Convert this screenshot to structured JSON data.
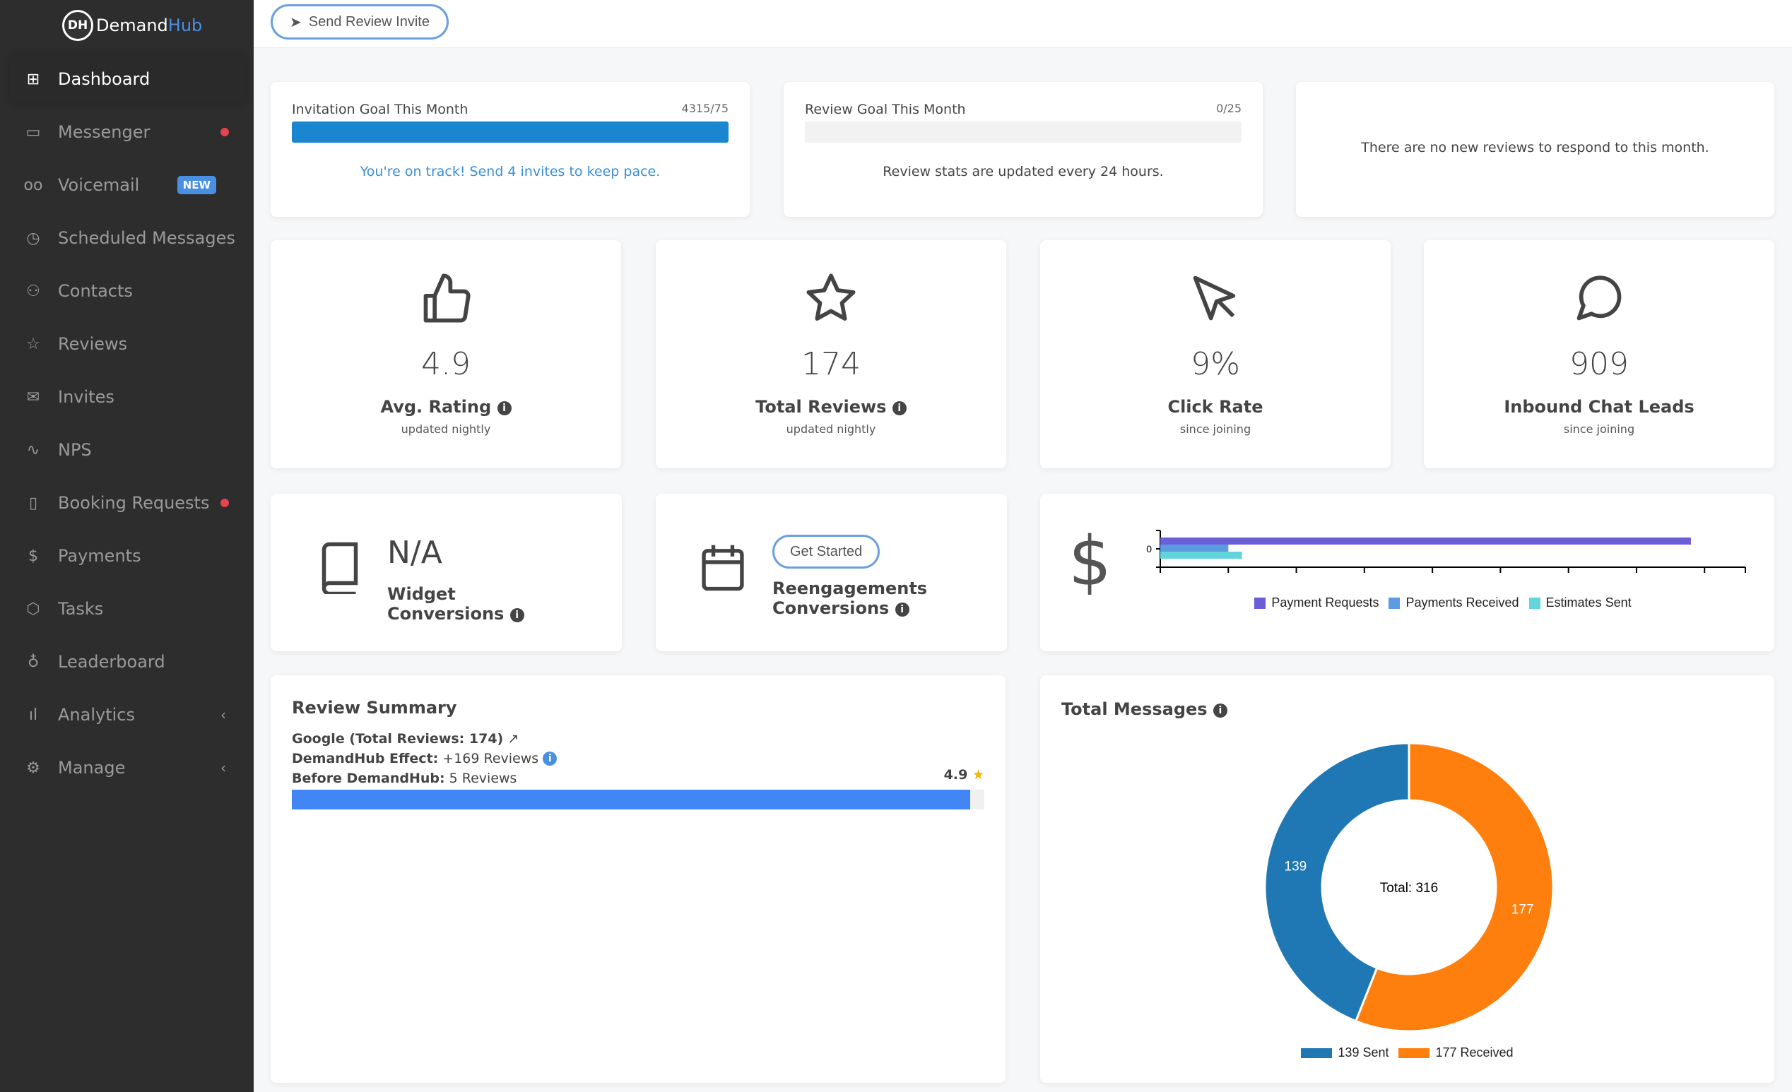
{
  "brand": {
    "logo_mark": "DH",
    "name_a": "Demand",
    "name_b": "Hub"
  },
  "sidebar": {
    "items": [
      {
        "label": "Dashboard",
        "icon": "grid-icon",
        "glyph": "⊞"
      },
      {
        "label": "Messenger",
        "icon": "message-icon",
        "glyph": "▭"
      },
      {
        "label": "Voicemail",
        "icon": "voicemail-icon",
        "glyph": "oo",
        "badge": "NEW"
      },
      {
        "label": "Scheduled Messages",
        "icon": "clock-icon",
        "glyph": "◷"
      },
      {
        "label": "Contacts",
        "icon": "users-icon",
        "glyph": "⚇"
      },
      {
        "label": "Reviews",
        "icon": "star-icon",
        "glyph": "☆"
      },
      {
        "label": "Invites",
        "icon": "mail-icon",
        "glyph": "✉"
      },
      {
        "label": "NPS",
        "icon": "activity-icon",
        "glyph": "∿"
      },
      {
        "label": "Booking Requests",
        "icon": "book-icon",
        "glyph": "▯"
      },
      {
        "label": "Payments",
        "icon": "dollar-icon",
        "glyph": "$"
      },
      {
        "label": "Tasks",
        "icon": "box-icon",
        "glyph": "⬡"
      },
      {
        "label": "Leaderboard",
        "icon": "award-icon",
        "glyph": "♁"
      },
      {
        "label": "Analytics",
        "icon": "bar-chart-icon",
        "glyph": "ıl"
      },
      {
        "label": "Manage",
        "icon": "settings-icon",
        "glyph": "⚙"
      }
    ]
  },
  "topbar": {
    "send_label": "Send Review Invite"
  },
  "invitation_goal": {
    "title": "Invitation Goal This Month",
    "count": "4315/75",
    "progress": 1.0,
    "message": "You're on track! Send 4 invites to keep pace."
  },
  "review_goal": {
    "title": "Review Goal This Month",
    "count": "0/25",
    "progress": 0,
    "message": "Review stats are updated every 24 hours."
  },
  "reviews_notice": "There are no new reviews to respond to this month.",
  "stats": [
    {
      "value": "4.9",
      "label": "Avg. Rating",
      "sub": "updated nightly",
      "icon": "thumbs-up-icon"
    },
    {
      "value": "174",
      "label": "Total Reviews",
      "sub": "updated nightly",
      "icon": "star-icon"
    },
    {
      "value": "9%",
      "label": "Click Rate",
      "sub": "since joining",
      "icon": "cursor-icon"
    },
    {
      "value": "909",
      "label": "Inbound Chat Leads",
      "sub": "since joining",
      "icon": "chat-icon"
    }
  ],
  "widget": {
    "value": "N/A",
    "label1": "Widget",
    "label2": "Conversions"
  },
  "reengage": {
    "button": "Get Started",
    "label1": "Reengagements",
    "label2": "Conversions"
  },
  "chart_data": [
    {
      "type": "bar",
      "orientation": "horizontal",
      "categories": [
        "0"
      ],
      "series": [
        {
          "name": "Payment Requests",
          "values": [
            39
          ],
          "color": "#6a5fd6"
        },
        {
          "name": "Payments Received",
          "values": [
            5
          ],
          "color": "#5b9be0"
        },
        {
          "name": "Estimates Sent",
          "values": [
            6
          ],
          "color": "#62d5da"
        }
      ],
      "xticks": [
        0,
        5,
        10,
        15,
        20,
        25,
        30,
        35,
        40
      ],
      "xlim": [
        0,
        43
      ],
      "legend": "bottom"
    },
    {
      "type": "pie",
      "title": "Total Messages",
      "center_label": "Total: 316",
      "slices": [
        {
          "name": "Sent",
          "value": 139,
          "legend": "139 Sent",
          "color": "#1f77b4"
        },
        {
          "name": "Received",
          "value": 177,
          "legend": "177 Received",
          "color": "#ff7f0e"
        }
      ],
      "legend": "bottom"
    }
  ],
  "review_summary": {
    "title": "Review Summary",
    "google": "Google (Total Reviews: 174)",
    "effect_label": "DemandHub Effect:",
    "effect_value": "+169 Reviews",
    "before_label": "Before DemandHub:",
    "before_value": "5 Reviews",
    "rating": "4.9",
    "bar_fraction": 0.98
  }
}
